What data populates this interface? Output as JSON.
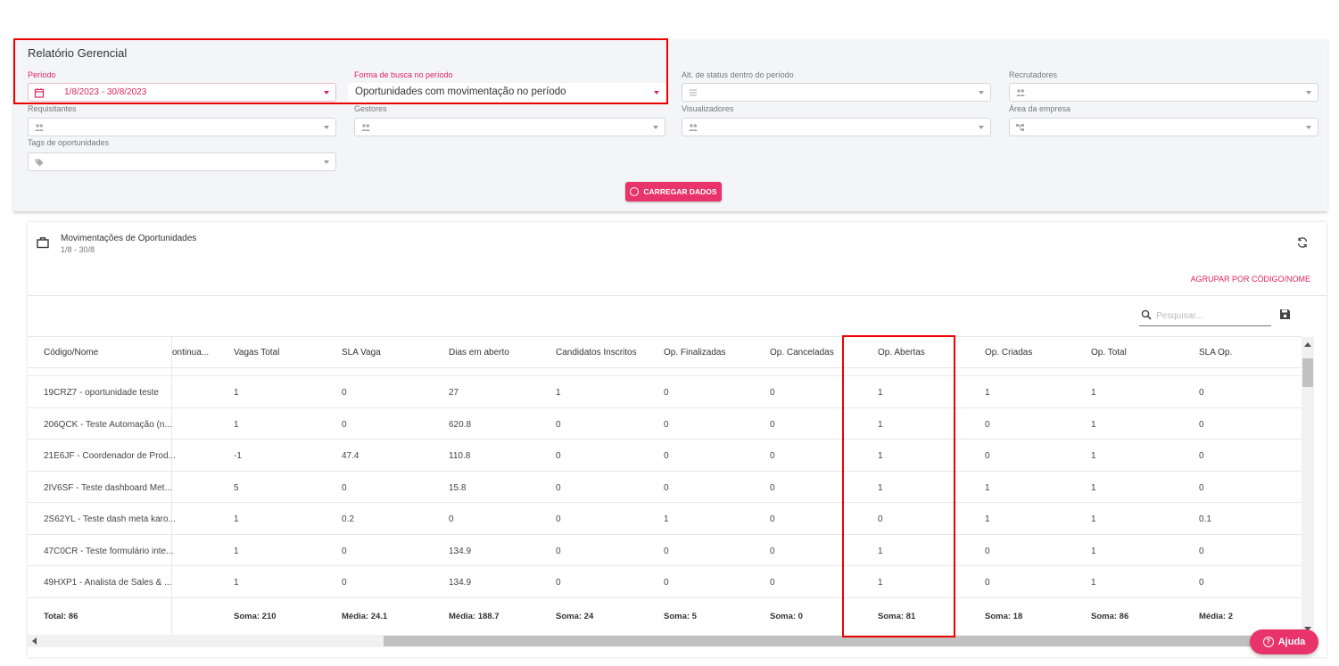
{
  "filters": {
    "title": "Relatório Gerencial",
    "periodo": {
      "label": "Período",
      "value": "1/8/2023 - 30/8/2023"
    },
    "forma_busca": {
      "label": "Forma de busca no período",
      "value": "Oportunidades com movimentação no período"
    },
    "alt_status": {
      "label": "Alt. de status dentro do período"
    },
    "recrutadores": {
      "label": "Recrutadores"
    },
    "requisitantes": {
      "label": "Requisitantes"
    },
    "gestores": {
      "label": "Gestores"
    },
    "visualizadores": {
      "label": "Visualizadores"
    },
    "area_empresa": {
      "label": "Área da empresa"
    },
    "tags": {
      "label": "Tags de oportunidades"
    },
    "load_button": "CARREGAR DADOS"
  },
  "report": {
    "title": "Movimentações de Oportunidades",
    "subtitle": "1/8 - 30/8",
    "group_link": "AGRUPAR POR CÓDIGO/NOME",
    "search_placeholder": "Pesquisar...",
    "columns": [
      "Código/Nome",
      "ontinua...",
      "Vagas Total",
      "SLA Vaga",
      "Dias em aberto",
      "Candidatos Inscritos",
      "Op. Finalizadas",
      "Op. Canceladas",
      "Op. Abertas",
      "Op. Criadas",
      "Op. Total",
      "SLA Op."
    ],
    "rows": [
      [
        "19CRZ7 - oportunidade teste",
        "",
        "1",
        "0",
        "27",
        "1",
        "0",
        "0",
        "1",
        "1",
        "1",
        "0"
      ],
      [
        "206QCK - Teste Automação (n...",
        "",
        "1",
        "0",
        "620.8",
        "0",
        "0",
        "0",
        "1",
        "0",
        "1",
        "0"
      ],
      [
        "21E6JF - Coordenador de Prod...",
        "",
        "-1",
        "47.4",
        "110.8",
        "0",
        "0",
        "0",
        "1",
        "0",
        "1",
        "0"
      ],
      [
        "2IV6SF - Teste dashboard Met...",
        "",
        "5",
        "0",
        "15.8",
        "0",
        "0",
        "0",
        "1",
        "1",
        "1",
        "0"
      ],
      [
        "2S62YL - Teste dash meta karo...",
        "",
        "1",
        "0.2",
        "0",
        "0",
        "1",
        "0",
        "0",
        "1",
        "1",
        "0.1"
      ],
      [
        "47C0CR - Teste formulário inte...",
        "",
        "1",
        "0",
        "134.9",
        "0",
        "0",
        "0",
        "1",
        "0",
        "1",
        "0"
      ],
      [
        "49HXP1 - Analista de Sales & ...",
        "",
        "1",
        "0",
        "134.9",
        "0",
        "0",
        "0",
        "1",
        "0",
        "1",
        "0"
      ]
    ],
    "footer": [
      "Total: 86",
      "",
      "Soma: 210",
      "Média: 24.1",
      "Média: 188.7",
      "Soma: 24",
      "Soma: 5",
      "Soma: 0",
      "Soma: 81",
      "Soma: 18",
      "Soma: 86",
      "Média: 2"
    ]
  },
  "help_button": "Ajuda",
  "colors": {
    "accent": "#e8336b",
    "highlight": "#ee0000",
    "panel_bg": "#f4f5f8"
  },
  "icons": [
    "calendar-icon",
    "list-icon",
    "people-icon",
    "tag-icon",
    "hierarchy-icon",
    "briefcase-icon",
    "refresh-icon",
    "search-icon",
    "save-icon",
    "help-icon"
  ]
}
